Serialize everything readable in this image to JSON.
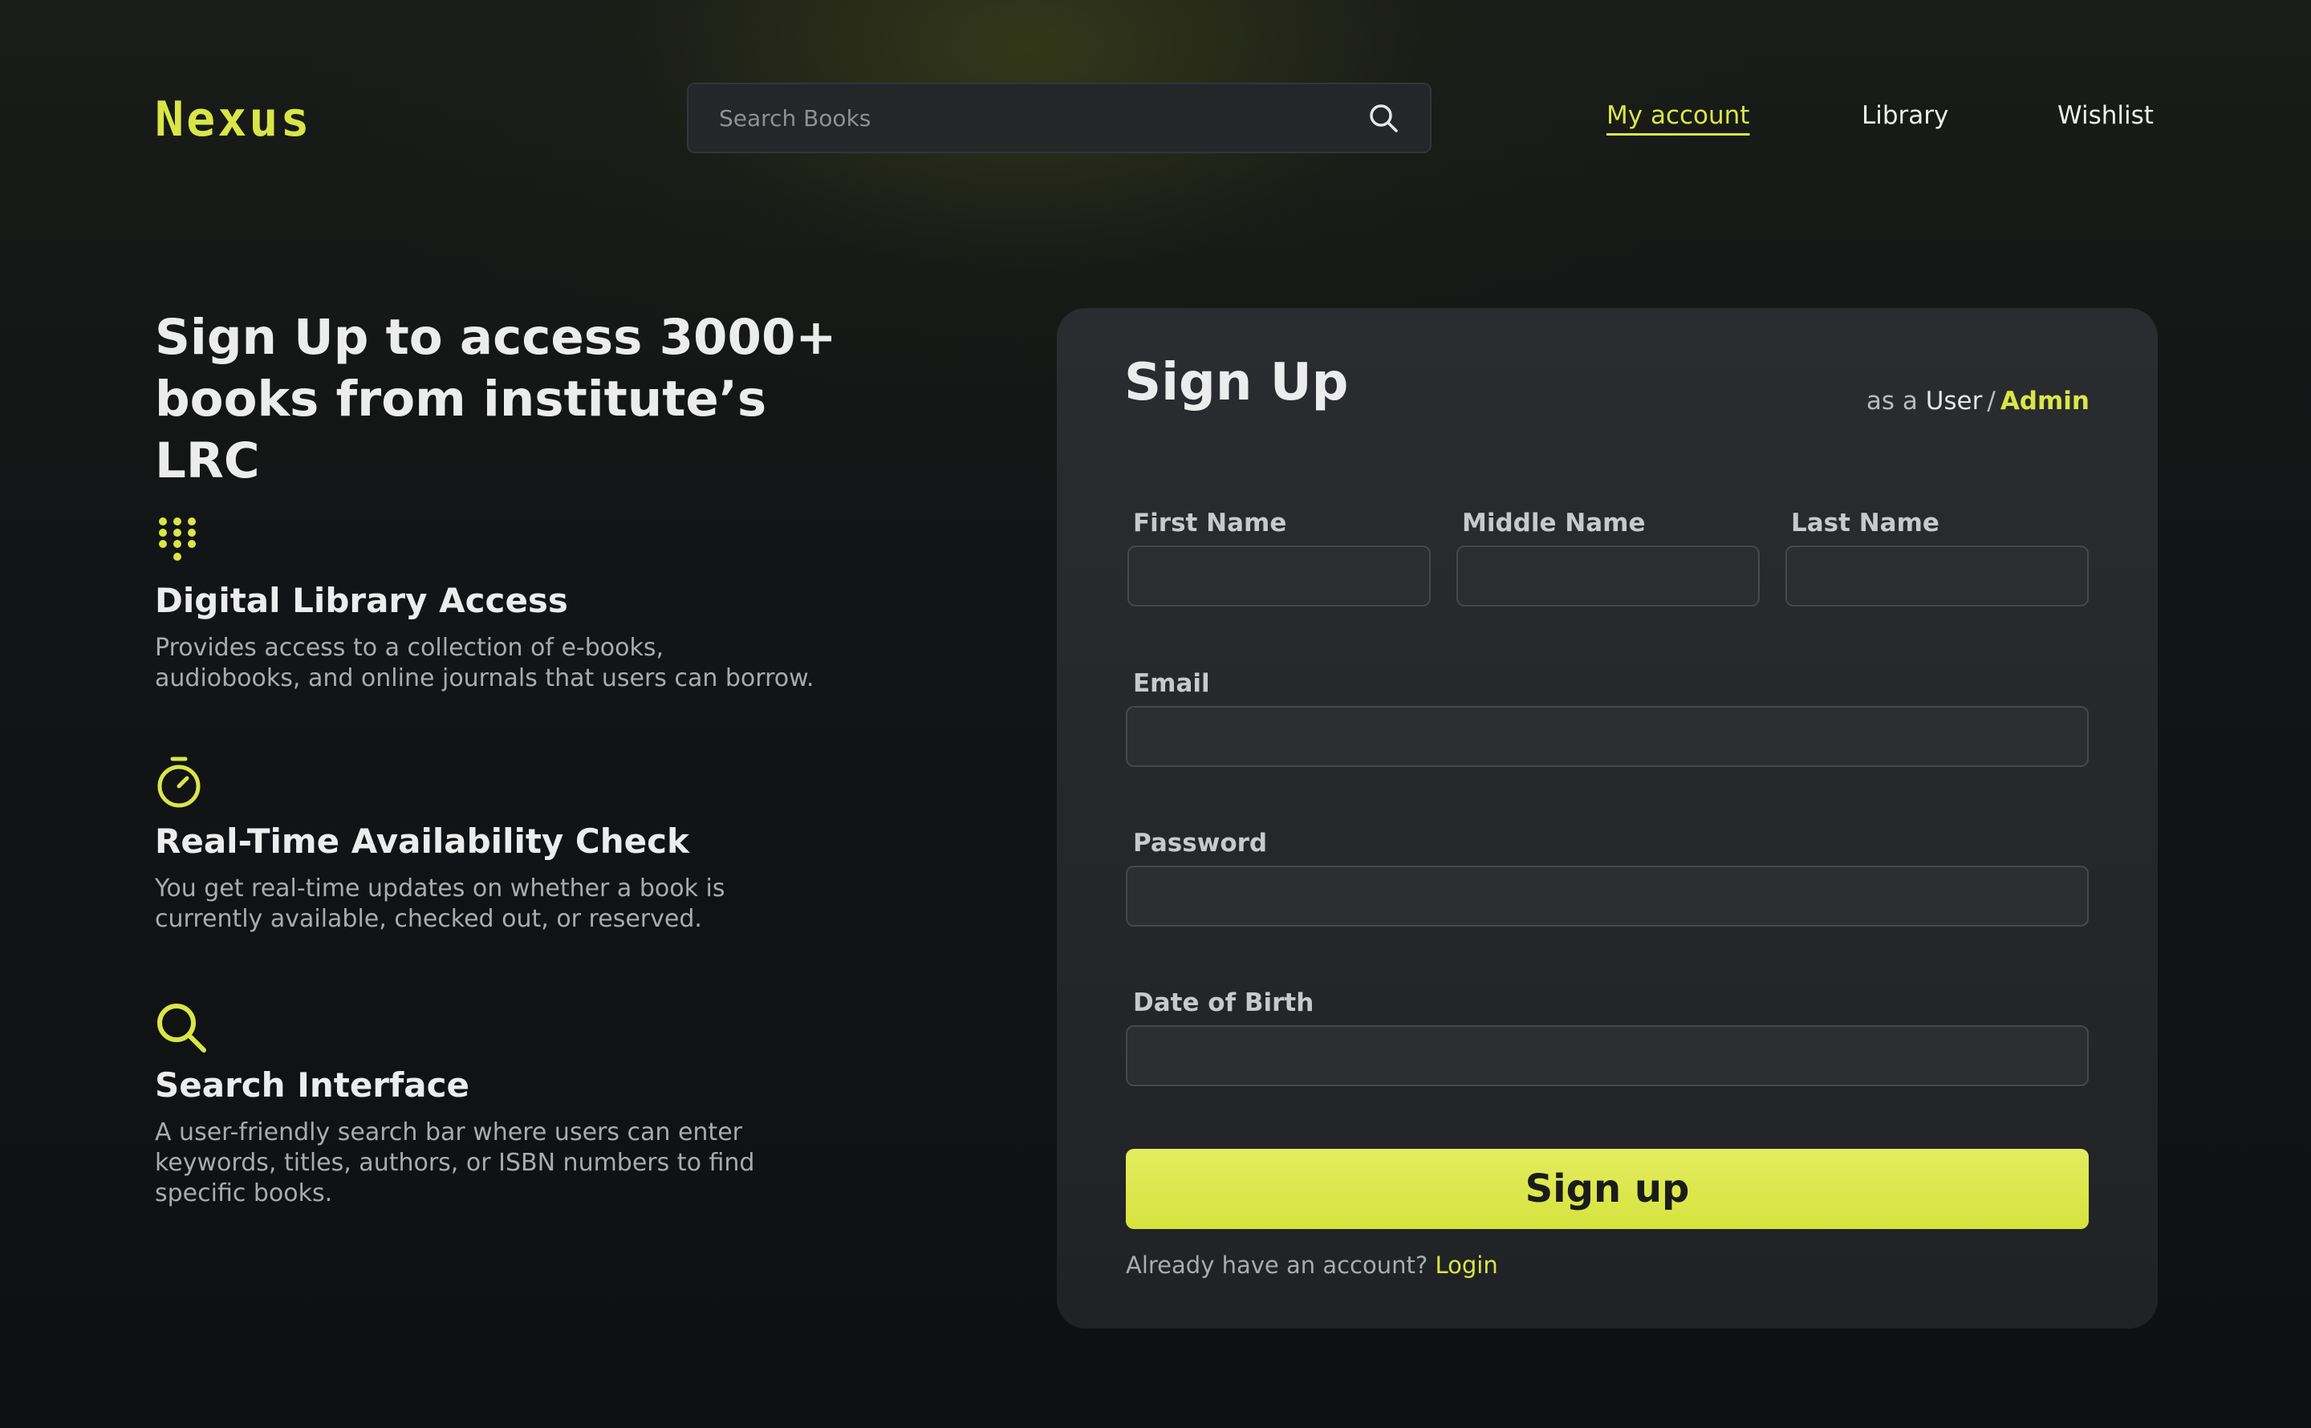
{
  "header": {
    "logo": "Nexus",
    "search": {
      "placeholder": "Search Books",
      "icon": "search-icon"
    },
    "nav": [
      {
        "label": "My account",
        "active": true
      },
      {
        "label": "Library",
        "active": false
      },
      {
        "label": "Wishlist",
        "active": false
      }
    ]
  },
  "hero": {
    "title": "Sign Up  to access 3000+\nbooks from institute’s LRC"
  },
  "features": [
    {
      "icon": "dialpad-icon",
      "title": "Digital Library Access",
      "description": "Provides access to a collection of e-books,\naudiobooks, and online journals that users can borrow."
    },
    {
      "icon": "stopwatch-icon",
      "title": "Real-Time Availability Check",
      "description": "You get real-time updates on whether a book is\ncurrently available, checked out, or reserved."
    },
    {
      "icon": "search-icon",
      "title": "Search Interface",
      "description": "A user-friendly search bar where users can enter\nkeywords, titles, authors, or ISBN numbers to find\nspecific books."
    }
  ],
  "form": {
    "title": "Sign Up",
    "role": {
      "prefix": "as a",
      "user": "User",
      "separator": "/",
      "admin": "Admin"
    },
    "fields": {
      "first_name": {
        "label": "First Name",
        "value": ""
      },
      "middle_name": {
        "label": "Middle Name",
        "value": ""
      },
      "last_name": {
        "label": "Last Name",
        "value": ""
      },
      "email": {
        "label": "Email",
        "value": ""
      },
      "password": {
        "label": "Password",
        "value": ""
      },
      "dob": {
        "label": "Date of Birth",
        "value": ""
      }
    },
    "submit_label": "Sign up",
    "footer": {
      "text": "Already have an account?",
      "link": "Login"
    }
  },
  "colors": {
    "accent": "#d9e648",
    "background": "#0f1114",
    "card": "#26282b"
  }
}
